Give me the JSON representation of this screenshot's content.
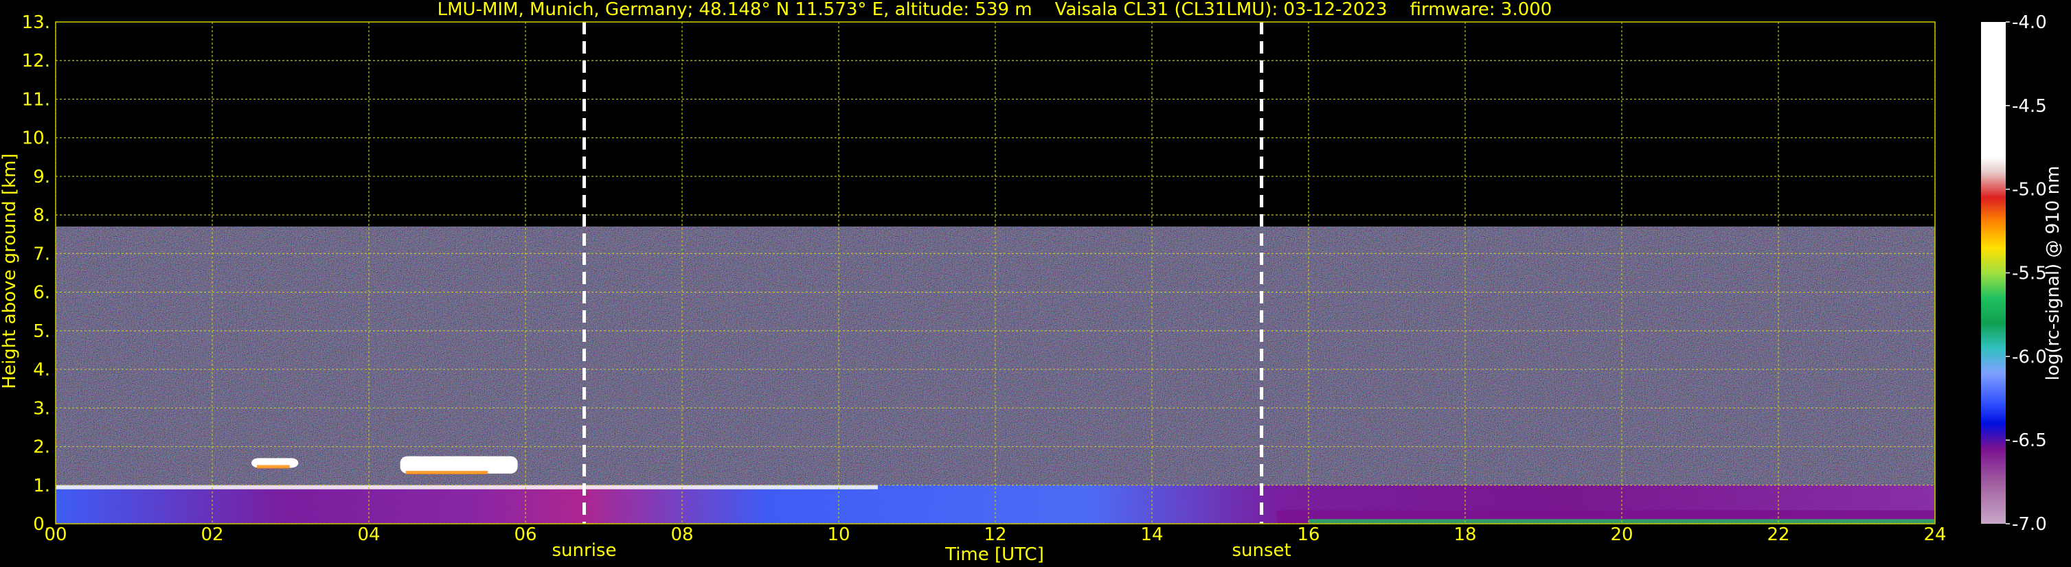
{
  "chart_data": {
    "type": "heatmap",
    "title": "LMU-MIM, Munich, Germany; 48.148° N 11.573° E, altitude: 539 m    Vaisala CL31 (CL31LMU): 03-12-2023    firmware: 3.000",
    "xlabel": "Time [UTC]",
    "ylabel": "Height above ground [km]",
    "xlim": [
      0,
      24
    ],
    "ylim": [
      0,
      13
    ],
    "x_ticks": [
      "00",
      "02",
      "04",
      "06",
      "08",
      "10",
      "12",
      "14",
      "16",
      "18",
      "20",
      "22",
      "24"
    ],
    "y_ticks": [
      "0.",
      "1.",
      "2.",
      "3.",
      "4.",
      "5.",
      "6.",
      "7.",
      "8.",
      "9.",
      "10.",
      "11.",
      "12.",
      "13."
    ],
    "grid": true,
    "colorbar": {
      "label": "log(rc-signal) @ 910 nm",
      "range": [
        -7.0,
        -4.0
      ],
      "ticks": [
        "-4.0",
        "-4.5",
        "-5.0",
        "-5.5",
        "-6.0",
        "-6.5",
        "-7.0"
      ]
    },
    "annotations": [
      {
        "label": "sunrise",
        "x": 6.75
      },
      {
        "label": "sunset",
        "x": 15.4
      }
    ],
    "noise_top_km": 7.7,
    "features": [
      {
        "kind": "boundary_layer",
        "x_start": 0,
        "x_end": 24,
        "top_km": 1.0
      },
      {
        "kind": "cloud",
        "x_start": 2.5,
        "x_end": 3.1,
        "base_km": 1.45,
        "top_km": 1.7
      },
      {
        "kind": "cloud",
        "x_start": 4.4,
        "x_end": 5.9,
        "base_km": 1.3,
        "top_km": 1.75
      }
    ]
  },
  "colors": {
    "text": "#ffff00",
    "grid": "#c8c800",
    "annotation_line": "#ffffff"
  }
}
